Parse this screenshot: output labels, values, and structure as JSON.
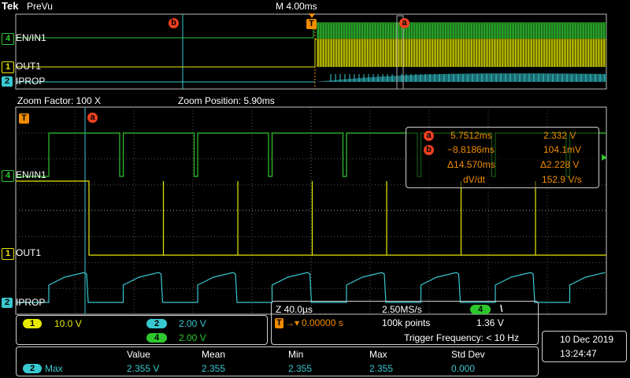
{
  "header": {
    "brand": "Tek",
    "mode": "PreVu",
    "timebase": "M 4.00ms"
  },
  "colors": {
    "ch1": "#e8e800",
    "ch2": "#38c8d0",
    "ch4": "#2ec82e",
    "trigger": "#f08c00",
    "cursor": "#f04020",
    "frame": "#c8c8c8"
  },
  "channels": {
    "ch4": {
      "number": "4",
      "name": "EN/IN1",
      "scale": "2.00 V"
    },
    "ch1": {
      "number": "1",
      "name": "OUT1",
      "scale": "10.0 V"
    },
    "ch2": {
      "number": "2",
      "name": "IPROP",
      "scale": "2.00 V"
    }
  },
  "markers": {
    "trigger": "T",
    "cursor_a": "a",
    "cursor_b": "b"
  },
  "zoom": {
    "factor": "Zoom Factor: 100 X",
    "position": "Zoom Position: 5.90ms"
  },
  "cursor_readout": {
    "a_time": "5.7512ms",
    "a_value": "2.332 V",
    "b_time": "−8.8186ms",
    "b_value": "104.1mV",
    "delta_time": "Δ14.570ms",
    "delta_value": "Δ2.228 V",
    "slope": "dV/dt",
    "slope_value": "152.9 V/s"
  },
  "acquisition": {
    "zoom_scale": "Z 40.0µs",
    "sample_rate": "2.50MS/s",
    "trigger_source": "4",
    "trigger_slope": "\\",
    "trigger_position": "0.00000 s",
    "record_length": "100k points",
    "trigger_level": "1.36 V",
    "trigger_frequency": "Trigger Frequency: < 10 Hz"
  },
  "clock": {
    "date": "10 Dec  2019",
    "time": "13:24:47"
  },
  "measurements": {
    "headers": [
      "Value",
      "Mean",
      "Min",
      "Max",
      "Std Dev"
    ],
    "channel": "2",
    "label": "Max",
    "values": [
      "2.355 V",
      "2.355",
      "2.355",
      "2.355",
      "0.000"
    ]
  }
}
